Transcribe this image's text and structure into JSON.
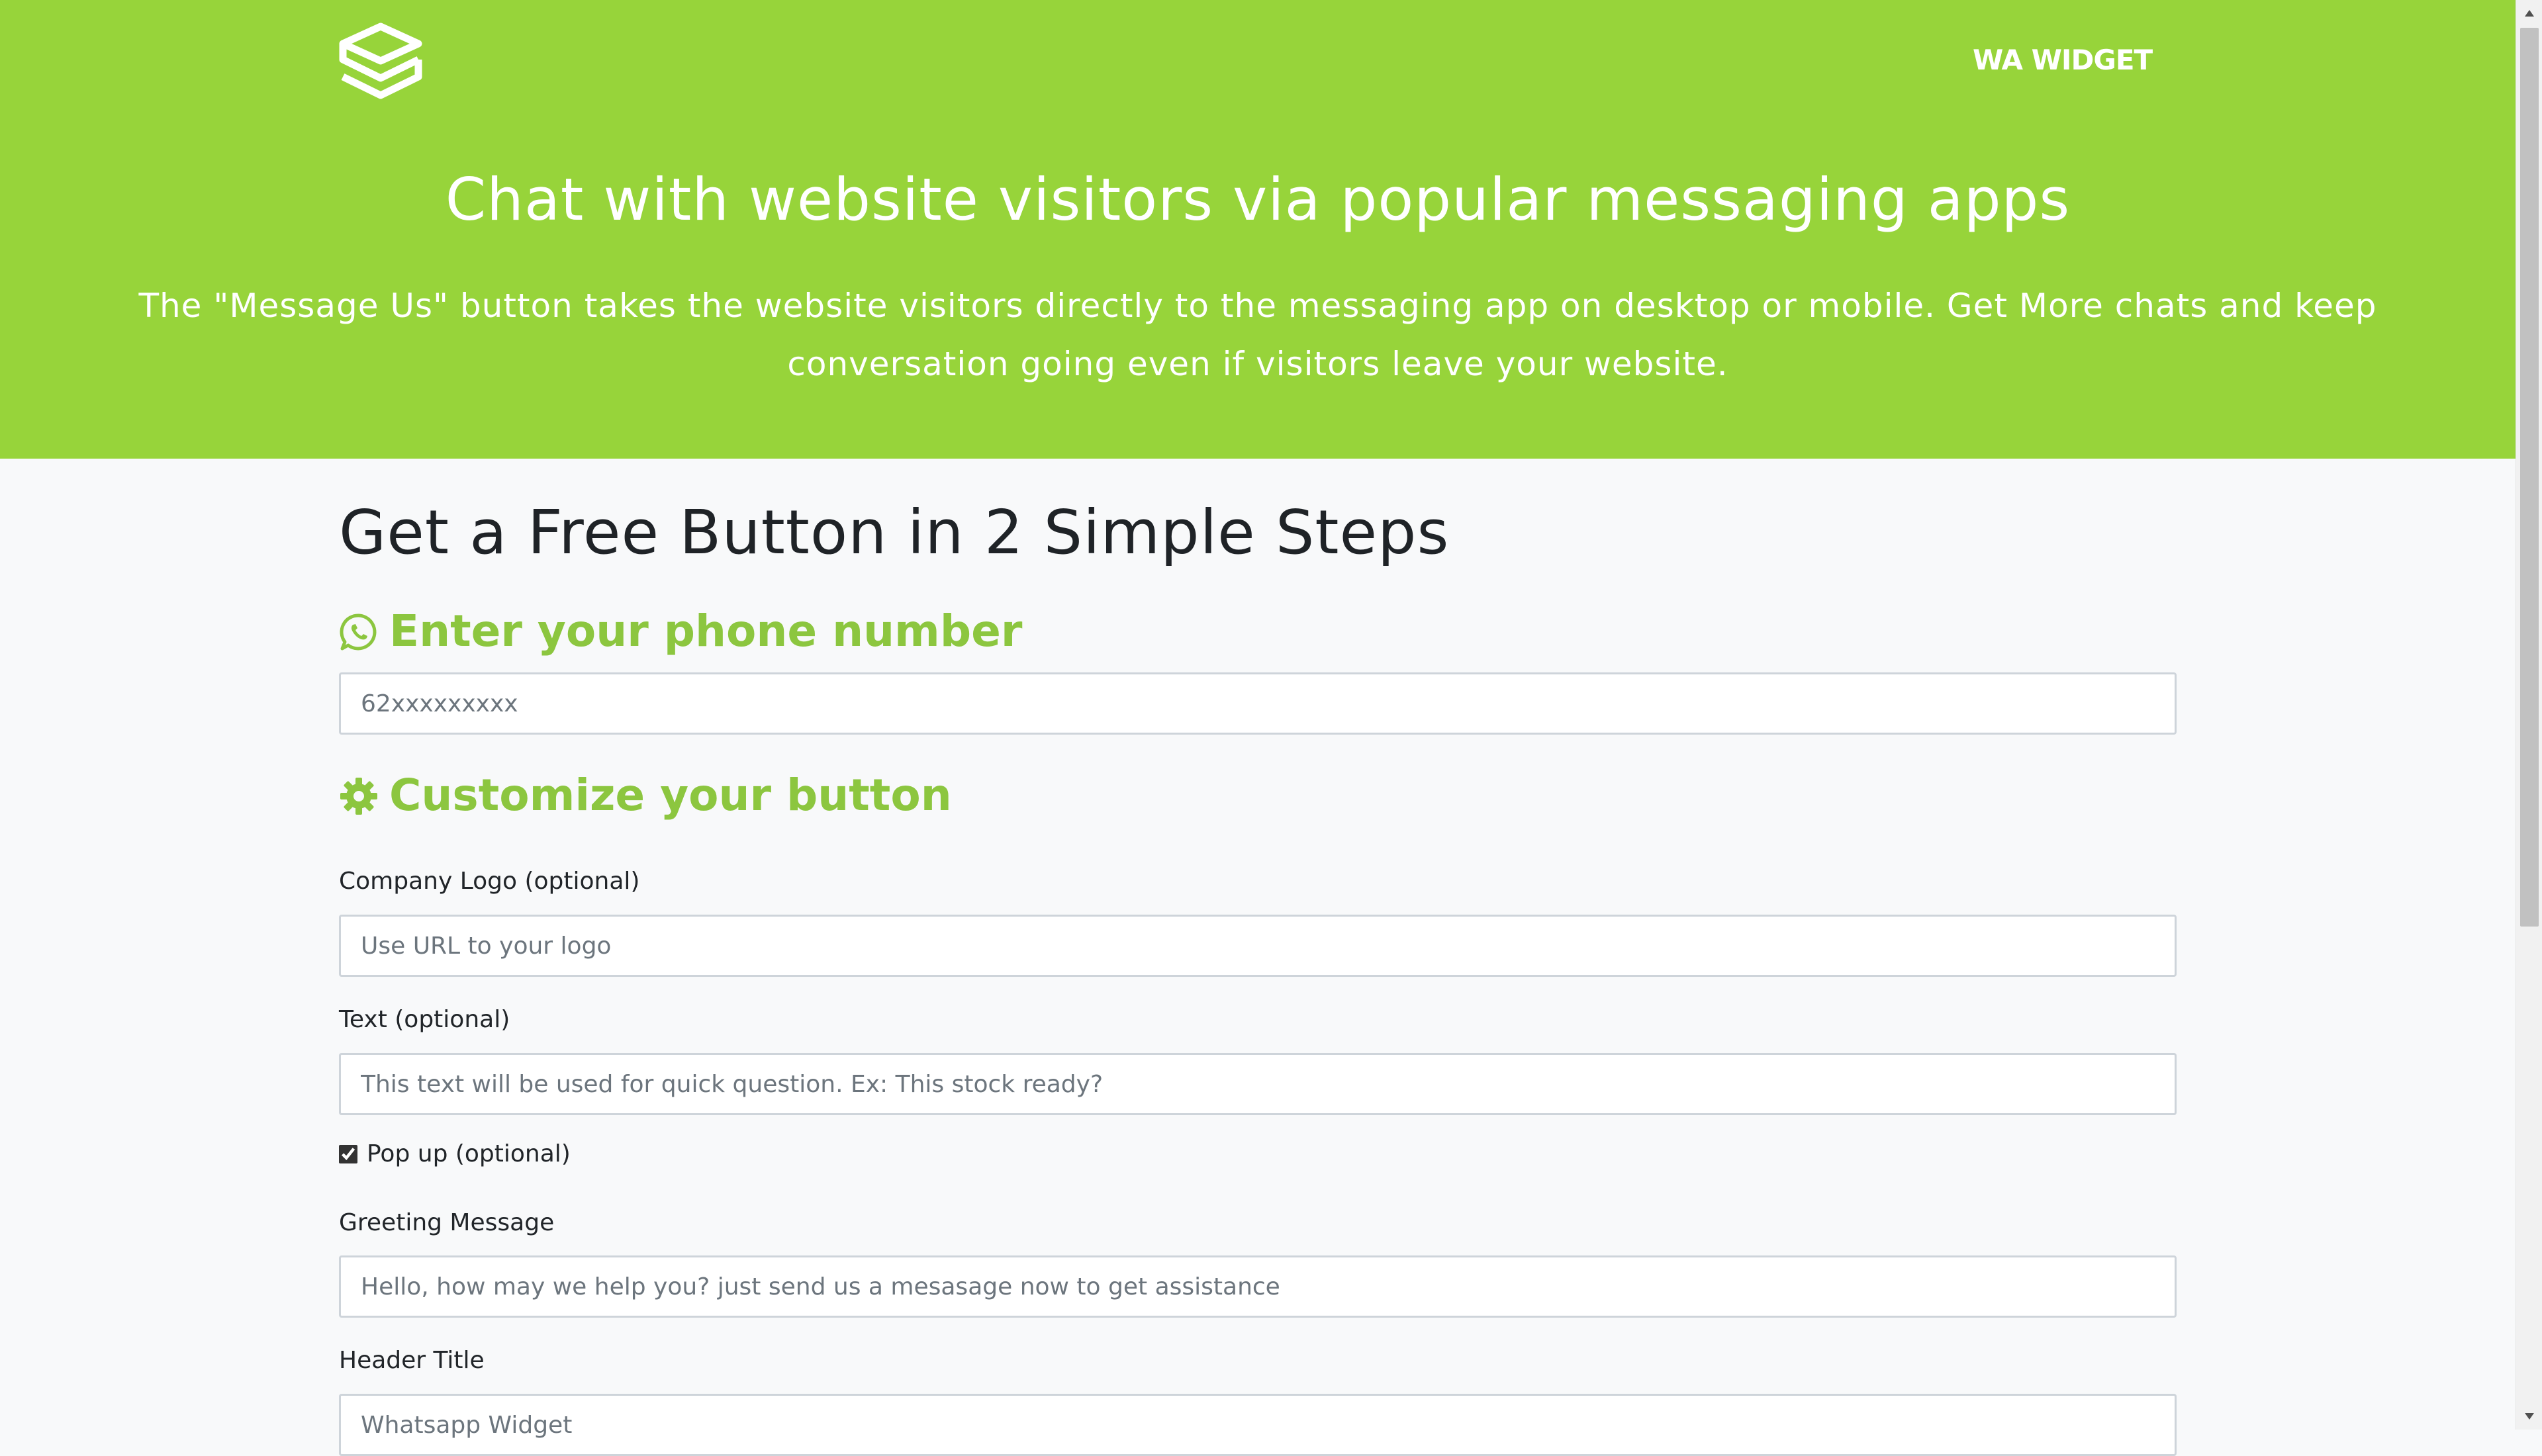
{
  "header": {
    "logo_icon": "stacked-s-logo-icon",
    "nav_link": "WA WIDGET",
    "title": "Chat with website visitors via popular messaging apps",
    "description": "The \"Message Us\" button takes the website visitors directly to the messaging app on desktop or mobile. Get More chats and keep conversation going even if visitors leave your website.",
    "background_color": "#97d43a"
  },
  "main": {
    "steps_title": "Get a Free Button in 2 Simple Steps",
    "accent_color": "#8cc63f",
    "phone_section": {
      "icon": "whatsapp-icon",
      "heading": "Enter your phone number",
      "placeholder": "62xxxxxxxxx"
    },
    "customize_section": {
      "icon": "gear-icon",
      "heading": "Customize your button",
      "logo_label": "Company Logo (optional)",
      "logo_placeholder": "Use URL to your logo",
      "text_label": "Text (optional)",
      "text_placeholder": "This text will be used for quick question. Ex: This stock ready?",
      "popup_label": "Pop up (optional)",
      "popup_checked": true,
      "greeting_label": "Greeting Message",
      "greeting_placeholder": "Hello, how may we help you? just send us a mesasage now to get assistance",
      "header_title_label": "Header Title",
      "header_title_placeholder": "Whatsapp Widget"
    }
  }
}
